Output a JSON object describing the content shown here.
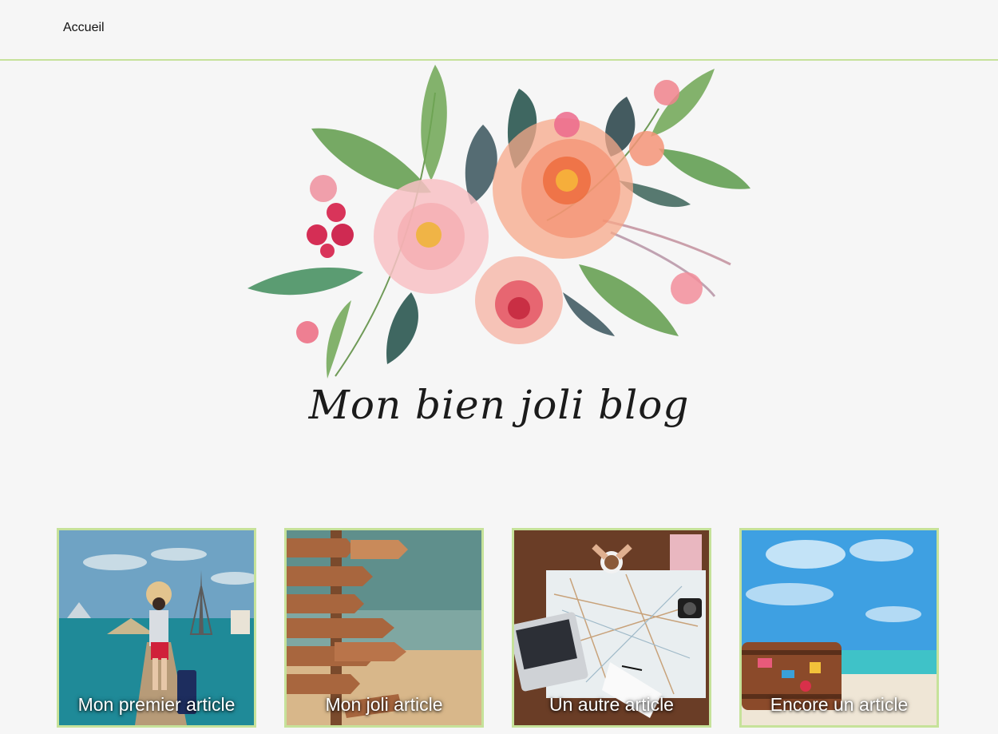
{
  "nav": {
    "home_label": "Accueil"
  },
  "hero": {
    "icon": "watercolor-flower-bouquet"
  },
  "blog": {
    "title": "Mon bien joli blog"
  },
  "colors": {
    "accent_border": "#c6e29a",
    "background": "#f6f6f6"
  },
  "articles": [
    {
      "title": "Mon premier article",
      "image": "traveler-on-pier-with-landmarks"
    },
    {
      "title": "Mon joli article",
      "image": "wooden-direction-signposts-at-beach"
    },
    {
      "title": "Un autre article",
      "image": "map-laptop-coffee-on-desk"
    },
    {
      "title": "Encore un article",
      "image": "suitcase-on-tropical-beach"
    }
  ]
}
